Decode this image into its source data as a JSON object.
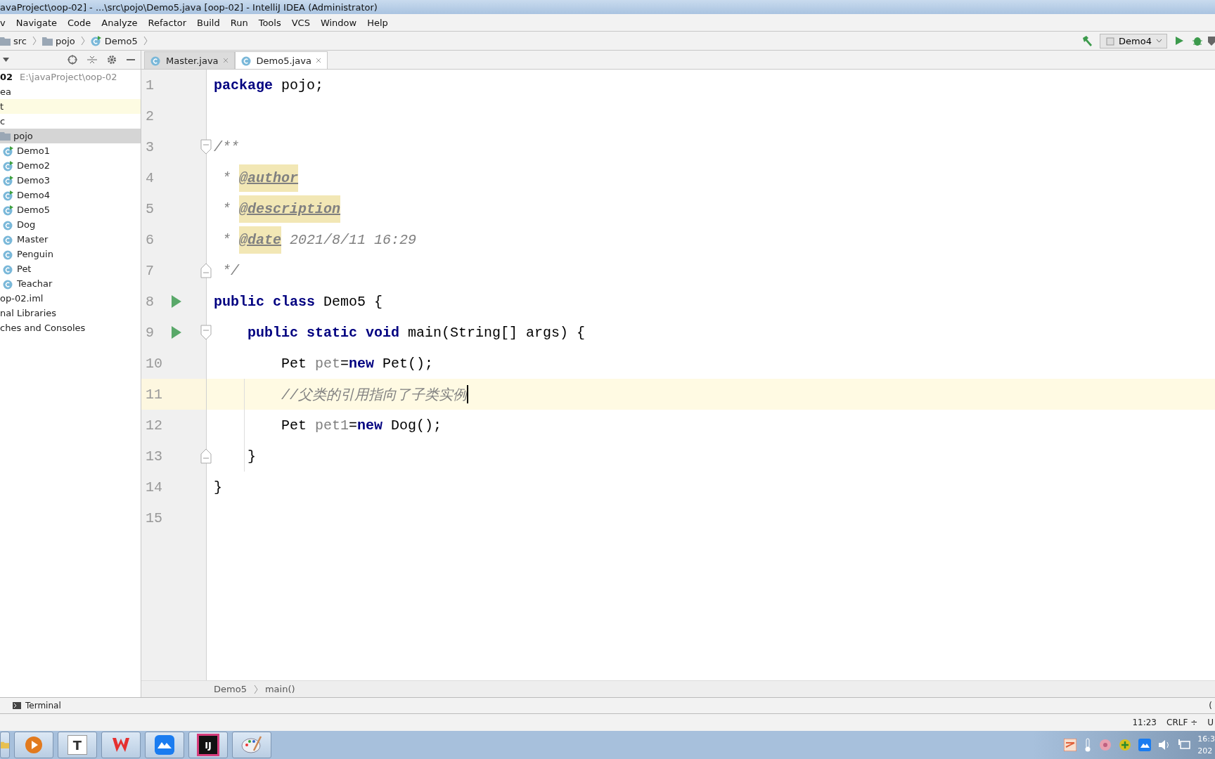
{
  "window": {
    "title": "avaProject\\oop-02] - ...\\src\\pojo\\Demo5.java [oop-02] - IntelliJ IDEA (Administrator)"
  },
  "menu": [
    "v",
    "Navigate",
    "Code",
    "Analyze",
    "Refactor",
    "Build",
    "Run",
    "Tools",
    "VCS",
    "Window",
    "Help"
  ],
  "navbar": {
    "crumbs": [
      {
        "text": "src",
        "kind": "folder"
      },
      {
        "text": "pojo",
        "kind": "folder"
      },
      {
        "text": "Demo5",
        "kind": "runnable"
      }
    ],
    "run_config": "Demo4"
  },
  "project_tree": [
    {
      "name": "02",
      "path": "E:\\javaProject\\oop-02",
      "selected": false,
      "children": [
        {
          "name": "ea",
          "selected": false
        },
        {
          "name": "t",
          "selected": false,
          "highlighted": true
        },
        {
          "name": "c",
          "selected": false,
          "children": [
            {
              "name": "pojo",
              "selected": true,
              "kind": "folder",
              "children": [
                {
                  "name": "Demo1",
                  "selected": false,
                  "kind": "runnable"
                },
                {
                  "name": "Demo2",
                  "selected": false,
                  "kind": "runnable"
                },
                {
                  "name": "Demo3",
                  "selected": false,
                  "kind": "runnable"
                },
                {
                  "name": "Demo4",
                  "selected": false,
                  "kind": "runnable"
                },
                {
                  "name": "Demo5",
                  "selected": false,
                  "kind": "runnable"
                },
                {
                  "name": "Dog",
                  "selected": false,
                  "kind": "class"
                },
                {
                  "name": "Master",
                  "selected": false,
                  "kind": "class"
                },
                {
                  "name": "Penguin",
                  "selected": false,
                  "kind": "class"
                },
                {
                  "name": "Pet",
                  "selected": false,
                  "kind": "class"
                },
                {
                  "name": "Teachar",
                  "selected": false,
                  "kind": "class"
                }
              ]
            }
          ]
        },
        {
          "name": "op-02.iml",
          "selected": false
        }
      ]
    },
    {
      "name": "nal Libraries",
      "selected": false
    },
    {
      "name": "ches and Consoles",
      "selected": false
    }
  ],
  "tabs": [
    {
      "label": "Master.java",
      "selected": false
    },
    {
      "label": "Demo5.java",
      "selected": true
    }
  ],
  "editor": {
    "lines": [
      {
        "number": "1",
        "current": false,
        "run": false,
        "fold_start": false,
        "fold_end": false,
        "tokens": [
          {
            "kind": "kw",
            "text": "package"
          },
          {
            "kind": "id",
            "text": " pojo;"
          }
        ]
      },
      {
        "number": "2",
        "current": false,
        "run": false,
        "fold_start": false,
        "fold_end": false
      },
      {
        "number": "3",
        "current": false,
        "run": false,
        "fold_start": true,
        "fold_end": false,
        "tokens": [
          {
            "kind": "doc",
            "text": "/**"
          }
        ]
      },
      {
        "number": "4",
        "current": false,
        "run": false,
        "fold_start": false,
        "fold_end": false,
        "tokens": [
          {
            "kind": "doc",
            "text": " * "
          },
          {
            "kind": "tag",
            "text": "@author"
          }
        ]
      },
      {
        "number": "5",
        "current": false,
        "run": false,
        "fold_start": false,
        "fold_end": false,
        "tokens": [
          {
            "kind": "doc",
            "text": " * "
          },
          {
            "kind": "tag",
            "text": "@description"
          }
        ]
      },
      {
        "number": "6",
        "current": false,
        "run": false,
        "fold_start": false,
        "fold_end": false,
        "tokens": [
          {
            "kind": "doc",
            "text": " * "
          },
          {
            "kind": "tag",
            "text": "@date"
          },
          {
            "kind": "doc",
            "text": " 2021/8/11 16:29"
          }
        ]
      },
      {
        "number": "7",
        "current": false,
        "run": false,
        "fold_start": false,
        "fold_end": true,
        "tokens": [
          {
            "kind": "doc",
            "text": " */"
          }
        ]
      },
      {
        "number": "8",
        "current": false,
        "run": true,
        "fold_start": false,
        "fold_end": false,
        "tokens": [
          {
            "kind": "kw",
            "text": "public class"
          },
          {
            "kind": "id",
            "text": " Demo5 {"
          }
        ]
      },
      {
        "number": "9",
        "current": false,
        "run": true,
        "fold_start": true,
        "fold_end": false,
        "tokens": [
          {
            "kind": "kw",
            "text": "    public static void"
          },
          {
            "kind": "id",
            "text": " main(String[] args) {"
          }
        ]
      },
      {
        "number": "10",
        "current": false,
        "run": false,
        "fold_start": false,
        "fold_end": false,
        "tokens": [
          {
            "kind": "id",
            "text": "        Pet "
          },
          {
            "kind": "var",
            "text": "pet"
          },
          {
            "kind": "id",
            "text": "="
          },
          {
            "kind": "kw",
            "text": "new"
          },
          {
            "kind": "id",
            "text": " Pet();"
          }
        ]
      },
      {
        "number": "11",
        "current": true,
        "run": false,
        "fold_start": false,
        "fold_end": false,
        "tokens": [
          {
            "kind": "comment",
            "text": "        //父类的引用指向了子类实例"
          }
        ]
      },
      {
        "number": "12",
        "current": false,
        "run": false,
        "fold_start": false,
        "fold_end": false,
        "tokens": [
          {
            "kind": "id",
            "text": "        Pet "
          },
          {
            "kind": "var",
            "text": "pet1"
          },
          {
            "kind": "id",
            "text": "="
          },
          {
            "kind": "kw",
            "text": "new"
          },
          {
            "kind": "id",
            "text": " Dog();"
          }
        ]
      },
      {
        "number": "13",
        "current": false,
        "run": false,
        "fold_start": false,
        "fold_end": true,
        "tokens": [
          {
            "kind": "id",
            "text": "    }"
          }
        ]
      },
      {
        "number": "14",
        "current": false,
        "run": false,
        "fold_start": false,
        "fold_end": false,
        "tokens": [
          {
            "kind": "id",
            "text": "}"
          }
        ]
      },
      {
        "number": "15",
        "current": false,
        "run": false,
        "fold_start": false,
        "fold_end": false
      }
    ],
    "breadcrumbs": [
      "Demo5",
      "main()"
    ]
  },
  "tool_strip": {
    "label": "Terminal",
    "right_text": "("
  },
  "status_bar": [
    "11:23",
    "CRLF ÷",
    "U"
  ],
  "taskbar": {
    "apps": [
      {
        "kind": "folder"
      },
      {
        "kind": "media"
      },
      {
        "kind": "letter",
        "text": "T"
      },
      {
        "kind": "wps"
      },
      {
        "kind": "cloud"
      },
      {
        "kind": "letter-dark",
        "text": "IJ"
      },
      {
        "kind": "paint"
      }
    ],
    "tray_time": "16:3",
    "tray_date": "202"
  }
}
